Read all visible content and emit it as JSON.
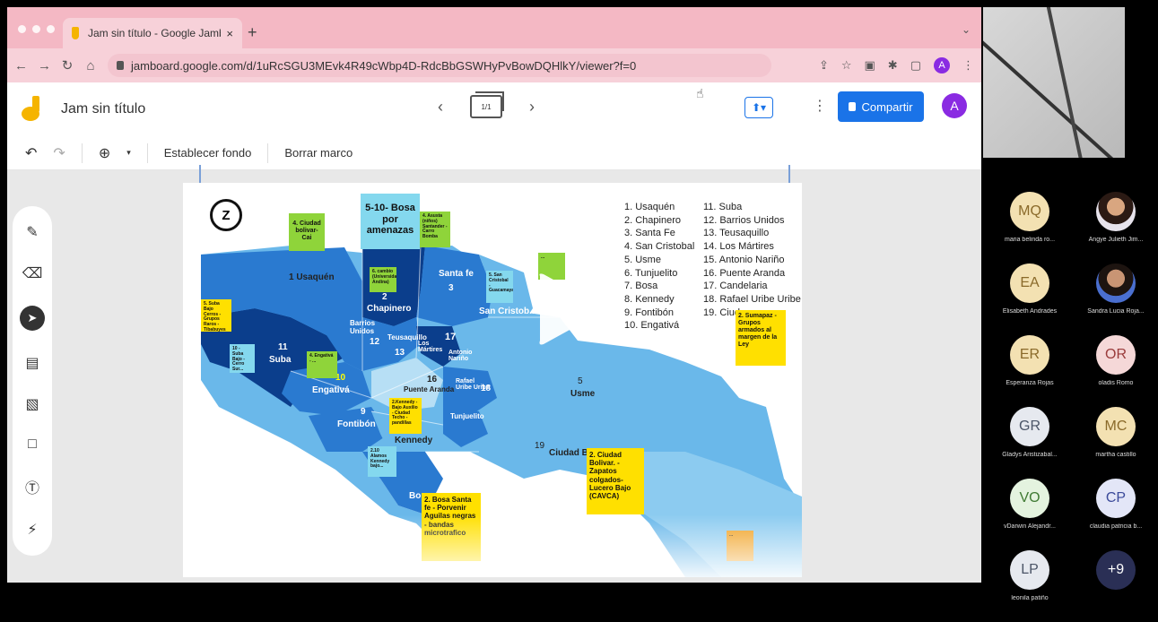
{
  "browser": {
    "tab_title": "Jam sin título - Google Jambo...",
    "tab_close": "×",
    "new_tab": "+",
    "tab_menu": "⌄",
    "url": "jamboard.google.com/d/1uRcSGU3MEvk4R49cWbp4D-RdcBbGSWHyPvBowDQHlkY/viewer?f=0",
    "account_initial": "A"
  },
  "app": {
    "title": "Jam sin título",
    "frame_counter": "1/1",
    "share_label": "Compartir",
    "avatar_initial": "A"
  },
  "toolbar": {
    "set_background": "Establecer fondo",
    "clear_frame": "Borrar marco"
  },
  "board": {
    "north_glyph": "Z",
    "legend_left": [
      "1. Usaquén",
      "2. Chapinero",
      "3. Santa Fe",
      "4. San Cristobal",
      "5. Usme",
      "6. Tunjuelito",
      "7. Bosa",
      "8. Kennedy",
      "9. Fontibón",
      "10. Engativá"
    ],
    "legend_right": [
      "11. Suba",
      "12. Barrios Unidos",
      "13. Teusaquillo",
      "14. Los Mártires",
      "15. Antonio Nariño",
      "16. Puente Aranda",
      "17. Candelaria",
      "18. Rafael Uribe Uribe",
      "19. Ciud..."
    ],
    "regions": {
      "usaquen": "1 Usaquén",
      "chapinero": "Chapinero",
      "chapinero_num": "2",
      "santafe": "Santa fe",
      "santafe_num": "3",
      "sancristobal": "San Cristob...",
      "suba_num": "11",
      "suba": "Suba",
      "barrios": "Barrios Unidos",
      "barrios_num": "12",
      "teusaquillo": "Teusaquillo",
      "teus_num": "13",
      "martires": "Los Mártires",
      "antonio": "Antonio Nariño",
      "candelaria_num": "17",
      "engativa_num": "10",
      "engativa": "Engativá",
      "puente_num": "16",
      "puente": "Puente Aranda",
      "rafael": "Rafael Uribe Uribe",
      "rafael_num": "18",
      "fontibon_num": "9",
      "fontibon": "Fontibón",
      "tunjuelito": "Tunjuelito",
      "kennedy": "Kennedy",
      "usme_num": "5",
      "usme": "Usme",
      "ciudad_num": "19",
      "ciudad": "Ciudad Bo...",
      "bosa": "Bo..."
    },
    "stickies": {
      "bosa_top": "5-10- Bosa por amenazas",
      "ciudad_bolivar_cai": "4. Ciudad bolivar- Cai",
      "note_small_top": "4. Asusta (niños) Santander - Carro Bomba",
      "sumapaz": "2. Sumapaz - Grupos armados al margen de la Ley",
      "ciudad_bolivar_zapatos": "2. Ciudad Bolivar. - Zapatos colgados- Lucero Bajo (CAVCA)",
      "bosa_santafe": "2. Bosa Santa fe - Porvenir Aguilas negras - bandas microtrafico",
      "note_left": "5. Suba Bajo Cerros - Grupos Raros - Tibabuyes",
      "note_suba": "10 - Suba Bajo - Cerro Sur...",
      "note_chapinero": "6. cambio (Universidad Andina)",
      "note_sc": "5. San Cristobal - Guacamayas",
      "note_engativa": "4. Engativá - ...",
      "note_kennedy": "2.Kennedy - Bajo Auxilio - Ciudad Techo - pandillas",
      "note_fontibon": "2.10 Alamos Kennedy bajo...",
      "note_orange": "...",
      "note_green_right": "..."
    }
  },
  "participants": [
    {
      "initials": "MQ",
      "name": "maria belinda ro...",
      "bg": "#f3e1b2",
      "fg": "#8a6a2a"
    },
    {
      "initials": "",
      "name": "Angye Julieth Jim...",
      "bg": "photo",
      "fg": "#fff"
    },
    {
      "initials": "EA",
      "name": "Elisabeth Andrades",
      "bg": "#f3e1b2",
      "fg": "#8a6a2a"
    },
    {
      "initials": "",
      "name": "Sandra Lucia Roja...",
      "bg": "photo2",
      "fg": "#fff"
    },
    {
      "initials": "ER",
      "name": "Esperanza Rojas",
      "bg": "#f3e1b2",
      "fg": "#8a6a2a"
    },
    {
      "initials": "OR",
      "name": "oladis Romo",
      "bg": "#f5d8d8",
      "fg": "#9a3b3b"
    },
    {
      "initials": "GR",
      "name": "Gladys Aristizabal...",
      "bg": "#e6e9ef",
      "fg": "#4b5567"
    },
    {
      "initials": "MC",
      "name": "martha castillo",
      "bg": "#f3e1b2",
      "fg": "#8a6a2a"
    },
    {
      "initials": "VO",
      "name": "vDarwin Alejandr...",
      "bg": "#e4f3df",
      "fg": "#3f7a33"
    },
    {
      "initials": "CP",
      "name": "claudia patricia b...",
      "bg": "#e3e6f7",
      "fg": "#3b4a9a"
    },
    {
      "initials": "LP",
      "name": "leonila patiño",
      "bg": "#e6e9ef",
      "fg": "#4b5567"
    },
    {
      "initials": "+9",
      "name": "",
      "bg": "#2a2f55",
      "fg": "#fff"
    }
  ],
  "colors": {
    "accent": "#1a73e8",
    "tab_pink": "#f4b8c4",
    "sticky_yellow": "#ffe000",
    "sticky_green": "#8fd43a",
    "sticky_cyan": "#84d8ee",
    "sticky_orange": "#f0a020",
    "map_dark": "#0b3e8c",
    "map_mid": "#2a7ad0",
    "map_light": "#6ab8ea"
  }
}
